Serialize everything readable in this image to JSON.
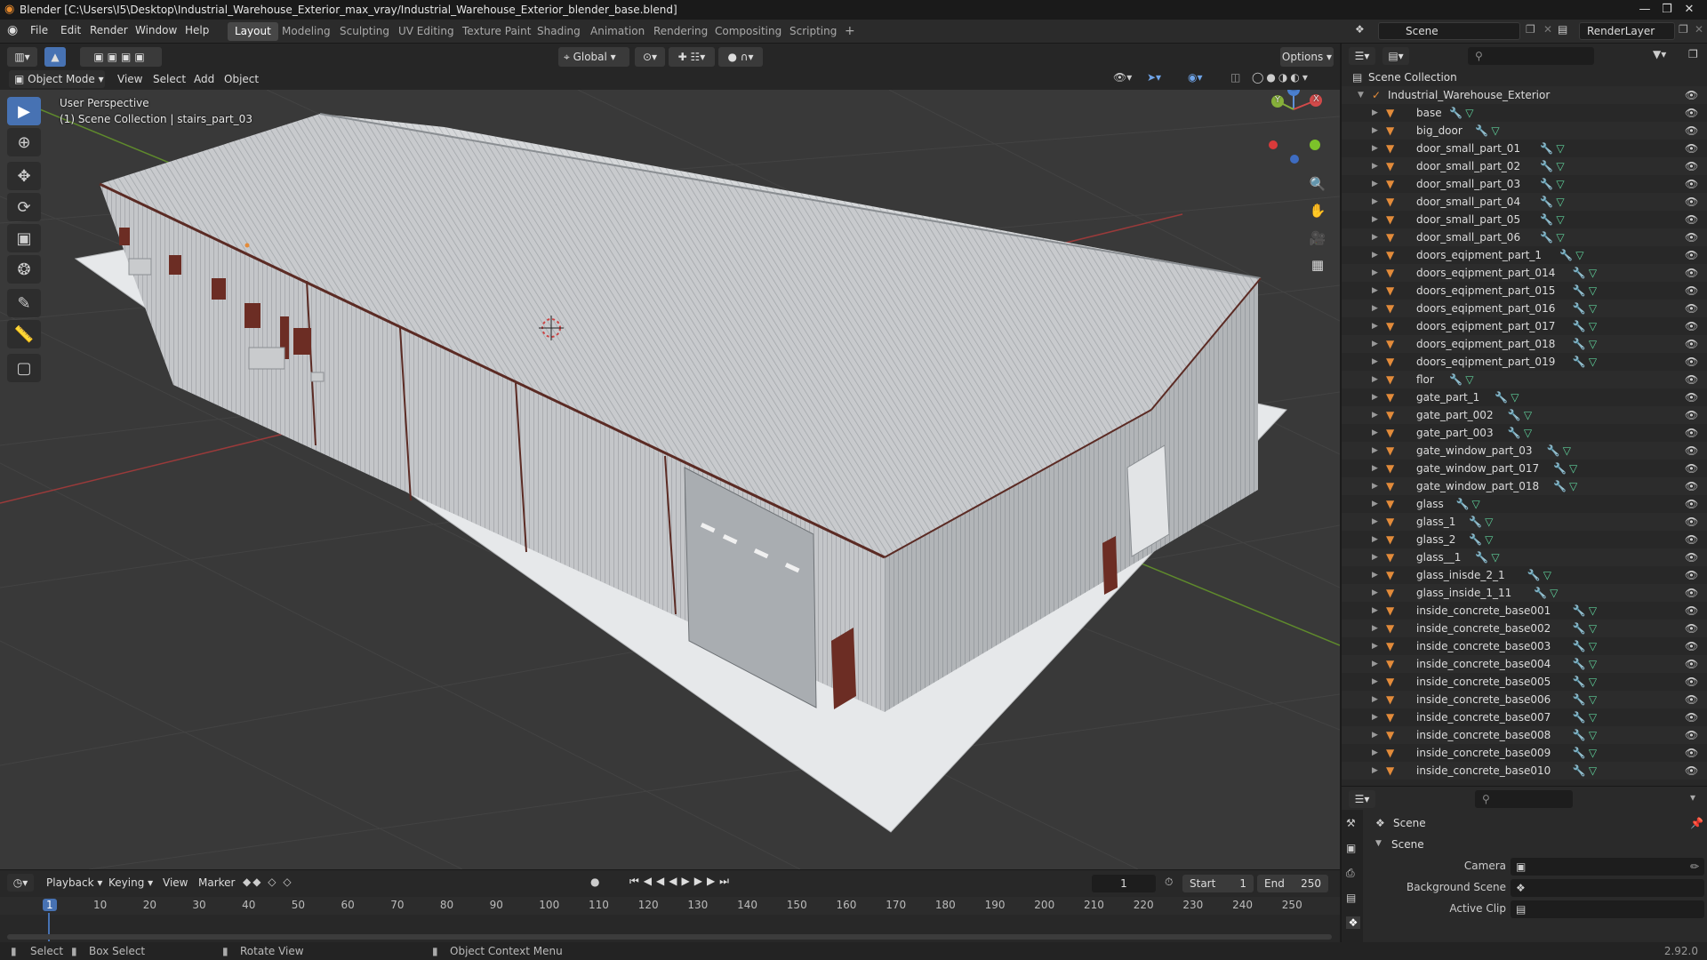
{
  "window": {
    "title": "Blender [C:\\Users\\I5\\Desktop\\Industrial_Warehouse_Exterior_max_vray/Industrial_Warehouse_Exterior_blender_base.blend]",
    "minimize": "—",
    "maximize": "❒",
    "close": "✕"
  },
  "menu": [
    "File",
    "Edit",
    "Render",
    "Window",
    "Help"
  ],
  "workspaces": [
    "Layout",
    "Modeling",
    "Sculpting",
    "UV Editing",
    "Texture Paint",
    "Shading",
    "Animation",
    "Rendering",
    "Compositing",
    "Scripting"
  ],
  "active_workspace": "Layout",
  "add_workspace": "+",
  "scene_name": "Scene",
  "render_layer": "RenderLayer",
  "viewport_header": {
    "transform_orientation": "Global",
    "options": "Options"
  },
  "viewport_menu": {
    "mode": "Object Mode",
    "items": [
      "View",
      "Select",
      "Add",
      "Object"
    ]
  },
  "viewport": {
    "perspective": "User Perspective",
    "collection_info": "(1) Scene Collection | stairs_part_03",
    "gizmo": {
      "x": "X",
      "y": "Y",
      "z": "Z"
    }
  },
  "outliner": {
    "root": "Scene Collection",
    "collection": "Industrial_Warehouse_Exterior",
    "objects": [
      "base",
      "big_door",
      "door_small_part_01",
      "door_small_part_02",
      "door_small_part_03",
      "door_small_part_04",
      "door_small_part_05",
      "door_small_part_06",
      "doors_eqipment_part_1",
      "doors_eqipment_part_014",
      "doors_eqipment_part_015",
      "doors_eqipment_part_016",
      "doors_eqipment_part_017",
      "doors_eqipment_part_018",
      "doors_eqipment_part_019",
      "flor",
      "gate_part_1",
      "gate_part_002",
      "gate_part_003",
      "gate_window_part_03",
      "gate_window_part_017",
      "gate_window_part_018",
      "glass",
      "glass_1",
      "glass_2",
      "glass__1",
      "glass_inisde_2_1",
      "glass_inside_1_11",
      "inside_concrete_base001",
      "inside_concrete_base002",
      "inside_concrete_base003",
      "inside_concrete_base004",
      "inside_concrete_base005",
      "inside_concrete_base006",
      "inside_concrete_base007",
      "inside_concrete_base008",
      "inside_concrete_base009",
      "inside_concrete_base010"
    ]
  },
  "properties": {
    "header": "Scene",
    "panel": "Scene",
    "fields": [
      {
        "label": "Camera",
        "value": ""
      },
      {
        "label": "Background Scene",
        "value": ""
      },
      {
        "label": "Active Clip",
        "value": ""
      }
    ]
  },
  "timeline": {
    "menus": [
      "Playback",
      "Keying",
      "View",
      "Marker"
    ],
    "current_frame": "1",
    "start_label": "Start",
    "start": "1",
    "end_label": "End",
    "end": "250",
    "ticks": [
      "1",
      "10",
      "20",
      "30",
      "40",
      "50",
      "60",
      "70",
      "80",
      "90",
      "100",
      "110",
      "120",
      "130",
      "140",
      "150",
      "160",
      "170",
      "180",
      "190",
      "200",
      "210",
      "220",
      "230",
      "240",
      "250"
    ]
  },
  "statusbar": {
    "select": "Select",
    "box_select": "Box Select",
    "rotate": "Rotate View",
    "context_menu": "Object Context Menu",
    "version": "2.92.0"
  },
  "colors": {
    "accent": "#4772b3",
    "object_orange": "#e38b3a",
    "mesh_green": "#5fd19b",
    "modifier_blue": "#6fa4e8",
    "playhead": "#4772b3"
  }
}
